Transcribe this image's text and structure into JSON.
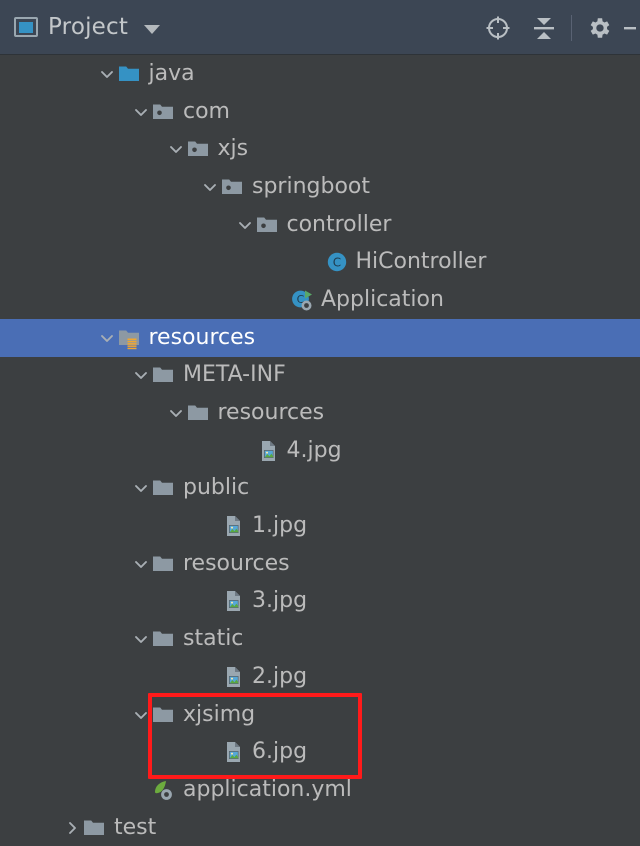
{
  "toolbar": {
    "title": "Project",
    "project_icon": "project-window-icon",
    "dropdown_icon": "chevron-down-icon",
    "buttons": [
      {
        "name": "locate-icon",
        "label": "Select Opened File"
      },
      {
        "name": "collapse-all-icon",
        "label": "Collapse All"
      },
      {
        "name": "settings-gear-icon",
        "label": "Settings"
      },
      {
        "name": "hide-icon",
        "label": "Hide"
      }
    ]
  },
  "colors": {
    "toolbar_bg": "#3c4654",
    "tree_bg": "#3c3f41",
    "selection_bg": "#4a6eb5",
    "text": "#bbbbbb",
    "selected_text": "#ffffff",
    "annotation": "#ff1a1a",
    "source_root_folder": "#3592c4",
    "plain_folder": "#8d99a3",
    "resource_root_accent": "#f0a732",
    "class_icon": "#3592c4",
    "run_arrow": "#59a869",
    "spring_leaf": "#6cab3e"
  },
  "tree": {
    "rows": [
      {
        "label": "java",
        "indent": 3,
        "twisty": "expanded",
        "icon": "source-root-folder-icon"
      },
      {
        "label": "com",
        "indent": 4,
        "twisty": "expanded",
        "icon": "package-folder-icon"
      },
      {
        "label": "xjs",
        "indent": 5,
        "twisty": "expanded",
        "icon": "package-folder-icon"
      },
      {
        "label": "springboot",
        "indent": 6,
        "twisty": "expanded",
        "icon": "package-folder-icon"
      },
      {
        "label": "controller",
        "indent": 7,
        "twisty": "expanded",
        "icon": "package-folder-icon"
      },
      {
        "label": "HiController",
        "indent": 9,
        "twisty": "none",
        "icon": "java-class-icon"
      },
      {
        "label": "Application",
        "indent": 8,
        "twisty": "none",
        "icon": "spring-boot-run-class-icon"
      },
      {
        "label": "resources",
        "indent": 3,
        "twisty": "expanded",
        "icon": "resource-root-folder-icon",
        "selected": true
      },
      {
        "label": "META-INF",
        "indent": 4,
        "twisty": "expanded",
        "icon": "folder-icon"
      },
      {
        "label": "resources",
        "indent": 5,
        "twisty": "expanded",
        "icon": "folder-icon"
      },
      {
        "label": "4.jpg",
        "indent": 7,
        "twisty": "none",
        "icon": "image-file-icon"
      },
      {
        "label": "public",
        "indent": 4,
        "twisty": "expanded",
        "icon": "folder-icon"
      },
      {
        "label": "1.jpg",
        "indent": 6,
        "twisty": "none",
        "icon": "image-file-icon"
      },
      {
        "label": "resources",
        "indent": 4,
        "twisty": "expanded",
        "icon": "folder-icon"
      },
      {
        "label": "3.jpg",
        "indent": 6,
        "twisty": "none",
        "icon": "image-file-icon"
      },
      {
        "label": "static",
        "indent": 4,
        "twisty": "expanded",
        "icon": "folder-icon"
      },
      {
        "label": "2.jpg",
        "indent": 6,
        "twisty": "none",
        "icon": "image-file-icon"
      },
      {
        "label": "xjsimg",
        "indent": 4,
        "twisty": "expanded",
        "icon": "folder-icon",
        "annotated": true
      },
      {
        "label": "6.jpg",
        "indent": 6,
        "twisty": "none",
        "icon": "image-file-icon",
        "annotated": true
      },
      {
        "label": "application.yml",
        "indent": 4,
        "twisty": "none",
        "icon": "spring-config-yml-icon"
      },
      {
        "label": "test",
        "indent": 2,
        "twisty": "collapsed",
        "icon": "folder-icon"
      }
    ]
  },
  "annotation": {
    "shape": "rectangle",
    "color": "#ff1a1a",
    "covers": [
      "xjsimg",
      "6.jpg"
    ]
  }
}
